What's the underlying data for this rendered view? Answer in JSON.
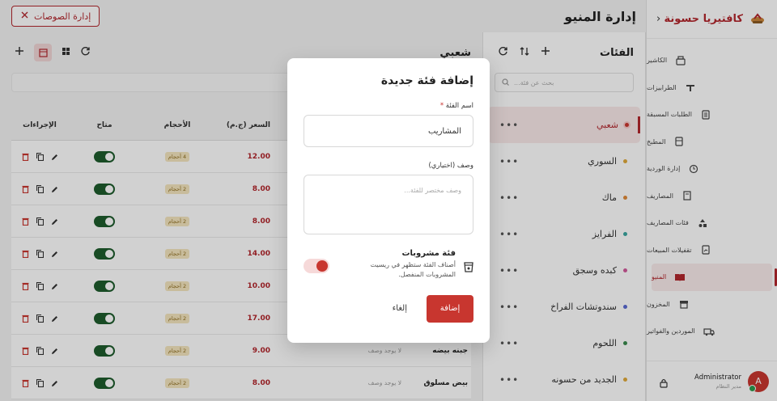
{
  "sidebar": {
    "brand": "كافتيريا حسونة",
    "items": [
      {
        "label": "الكاشير",
        "icon": "cashier-icon"
      },
      {
        "label": "الطرابيزات",
        "icon": "table-icon"
      },
      {
        "label": "الطلبات المسبقة",
        "icon": "preorder-icon"
      },
      {
        "label": "المطبخ",
        "icon": "kitchen-icon"
      },
      {
        "label": "إدارة الوردية",
        "icon": "shift-icon"
      },
      {
        "label": "المصاريف",
        "icon": "expenses-icon"
      },
      {
        "label": "فئات المصاريف",
        "icon": "expense-categories-icon"
      },
      {
        "label": "تقفيلات المبيعات",
        "icon": "sales-closing-icon"
      },
      {
        "label": "المنيو",
        "icon": "menu-book-icon"
      },
      {
        "label": "المخزون",
        "icon": "inventory-icon"
      },
      {
        "label": "الموردين والفواتير",
        "icon": "truck-icon"
      }
    ],
    "user": {
      "name": "Administrator",
      "role": "مدير النظام",
      "initial": "A"
    }
  },
  "header": {
    "title": "إدارة المنيو",
    "sauces_button": "إدارة الصوصات"
  },
  "categories": {
    "title": "الفئات",
    "search_placeholder": "بحث عن فئة...",
    "items": [
      {
        "label": "شعبي",
        "color": "#c8362f"
      },
      {
        "label": "السوري",
        "color": "#e0a93a"
      },
      {
        "label": "ماك",
        "color": "#e08a3a"
      },
      {
        "label": "الفرايز",
        "color": "#3aa6a0"
      },
      {
        "label": "كبده وسجق",
        "color": "#d25a9c"
      },
      {
        "label": "سندوتشات الفراخ",
        "color": "#5a6ad2"
      },
      {
        "label": "اللحوم",
        "color": "#3a8a4e"
      },
      {
        "label": "الجديد من حسونه",
        "color": "#e0a93a"
      }
    ]
  },
  "items_panel": {
    "title": "شعبي",
    "columns": {
      "actions": "الإجراءات",
      "available": "متاح",
      "sizes": "الأحجام",
      "price": "السعر (ج.م)"
    },
    "rows": [
      {
        "name": "",
        "desc": "",
        "price": "12.00",
        "sizes": "4 أحجام"
      },
      {
        "name": "",
        "desc": "",
        "price": "8.00",
        "sizes": "2 أحجام"
      },
      {
        "name": "",
        "desc": "",
        "price": "8.00",
        "sizes": "2 أحجام"
      },
      {
        "name": "",
        "desc": "",
        "price": "14.00",
        "sizes": "2 أحجام"
      },
      {
        "name": "",
        "desc": "",
        "price": "10.00",
        "sizes": "2 أحجام"
      },
      {
        "name": "",
        "desc": "",
        "price": "17.00",
        "sizes": "2 أحجام"
      },
      {
        "name": "جبنه بيضه",
        "desc": "لا يوجد وصف",
        "price": "9.00",
        "sizes": "2 أحجام"
      },
      {
        "name": "بيض مسلوق",
        "desc": "لا يوجد وصف",
        "price": "8.00",
        "sizes": "2 أحجام"
      }
    ]
  },
  "modal": {
    "title": "إضافة فئة جديدة",
    "name_label": "اسم الفئة",
    "name_required": "*",
    "name_value": "المشاريب",
    "desc_label": "وصف (اختياري)",
    "desc_placeholder": "وصف مختصر للفئة...",
    "toggle_title": "فئة مشروبات",
    "toggle_desc": "أصناف الفئة ستظهر في ريسيت المشروبات المنفصل.",
    "submit": "إضافة",
    "cancel": "إلغاء"
  }
}
